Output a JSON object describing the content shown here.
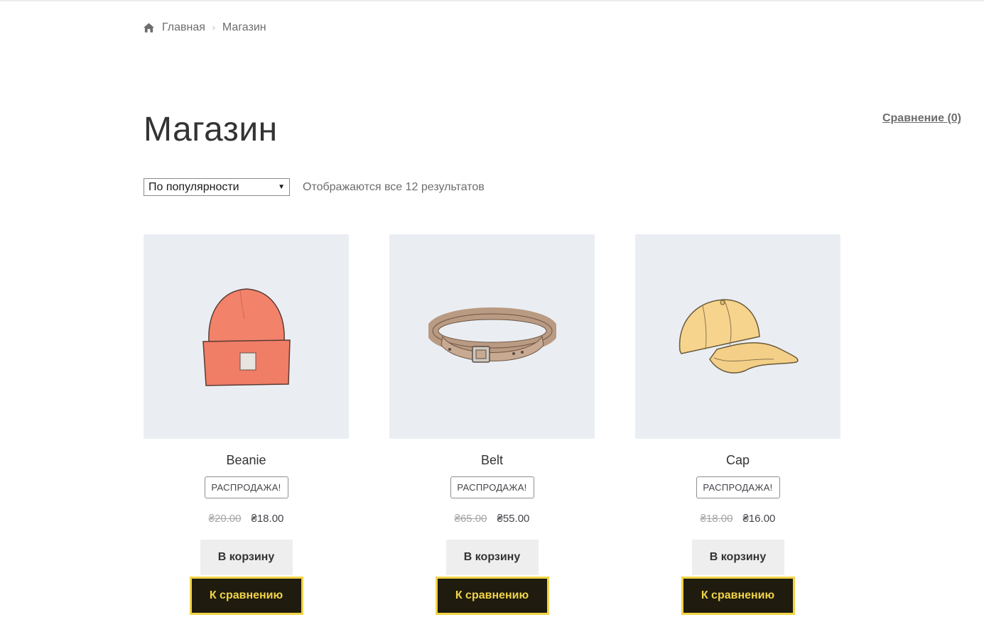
{
  "breadcrumb": {
    "home": "Главная",
    "current": "Магазин"
  },
  "page_title": "Магазин",
  "compare_link": "Сравнение (0)",
  "sorting": {
    "selected": "По популярности",
    "result_count": "Отображаются все 12 результатов"
  },
  "products": [
    {
      "title": "Beanie",
      "badge": "РАСПРОДАЖА!",
      "old_price": "₴20.00",
      "new_price": "₴18.00",
      "cart_label": "В корзину",
      "compare_label": "К сравнению",
      "image_icon": "beanie-image"
    },
    {
      "title": "Belt",
      "badge": "РАСПРОДАЖА!",
      "old_price": "₴65.00",
      "new_price": "₴55.00",
      "cart_label": "В корзину",
      "compare_label": "К сравнению",
      "image_icon": "belt-image"
    },
    {
      "title": "Cap",
      "badge": "РАСПРОДАЖА!",
      "old_price": "₴18.00",
      "new_price": "₴16.00",
      "cart_label": "В корзину",
      "compare_label": "К сравнению",
      "image_icon": "cap-image"
    }
  ],
  "colors": {
    "compare_bg": "#1f1b0e",
    "compare_accent": "#f0d449",
    "image_bg": "#eaeef3"
  }
}
